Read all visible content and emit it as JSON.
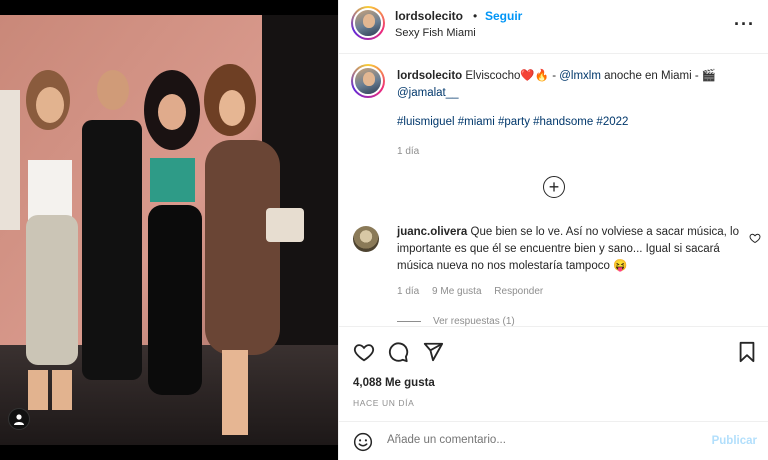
{
  "post": {
    "photo": {
      "alt": "Group photo of four people at Sexy Fish Miami",
      "user_tag_icon": "person-icon"
    },
    "header": {
      "username": "lordsolecito",
      "separator": "•",
      "follow_label": "Seguir",
      "location": "Sexy Fish Miami",
      "more_icon": "more-horizontal-icon"
    },
    "caption": {
      "username": "lordsolecito",
      "text_part1": "Elviscocho❤️🔥 - ",
      "mention1": "@lmxlm",
      "text_part2": " anoche en Miami - 🎬 ",
      "mention2": "@jamalat__",
      "hashtags": "#luismiguel #miami #party #handsome #2022",
      "time": "1 día"
    },
    "load_more_icon": "plus-circle-icon",
    "comment": {
      "username": "juanc.olivera",
      "text": "Que bien se lo ve. Así no volviese a sacar música, lo importante es que él se encuentre bien y sano... Igual si sacará música nueva no nos molestaría tampoco 😝",
      "time": "1 día",
      "likes": "9 Me gusta",
      "reply_label": "Responder",
      "view_replies": "Ver respuestas (1)",
      "heart_icon": "heart-outline-icon"
    },
    "actions": {
      "like_icon": "heart-icon",
      "comment_icon": "comment-icon",
      "share_icon": "send-icon",
      "save_icon": "bookmark-icon"
    },
    "likes_count": "4,088 Me gusta",
    "time_ago": "HACE UN DÍA",
    "composer": {
      "emoji_icon": "smiley-icon",
      "placeholder": "Añade un comentario...",
      "publish_label": "Publicar"
    },
    "colors": {
      "link": "#00376b",
      "follow": "#0095f6",
      "muted": "#8e8e8e",
      "publish_disabled": "#b2dffc"
    }
  }
}
